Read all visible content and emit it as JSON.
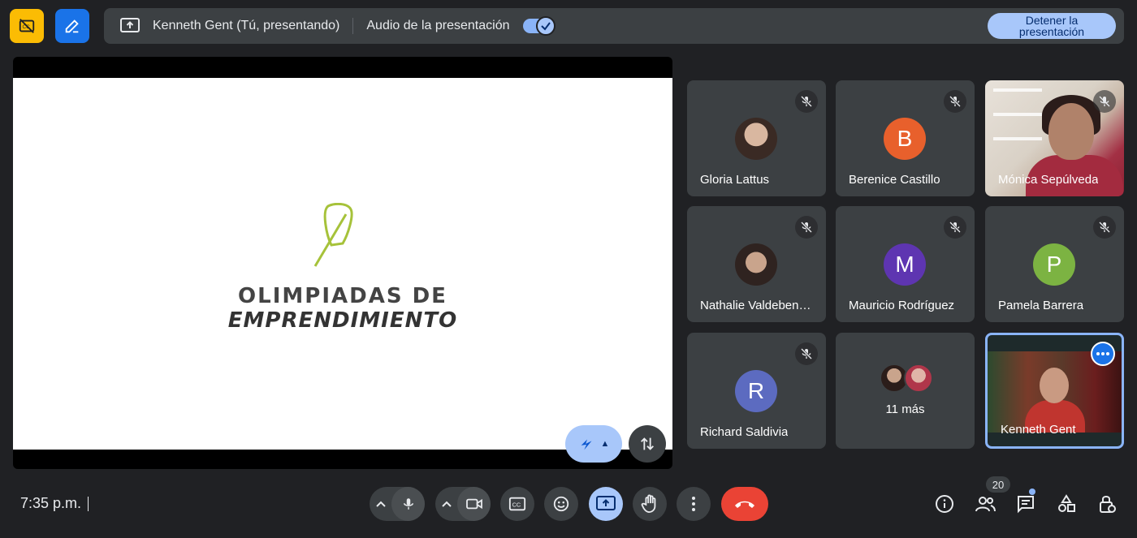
{
  "topbar": {
    "presenter_label": "Kenneth Gent (Tú, presentando)",
    "audio_label": "Audio de la presentación",
    "audio_enabled": true,
    "stop_button_label": "Detener la presentación"
  },
  "slide": {
    "line1": "OLIMPIADAS DE",
    "line2": "EMPRENDIMIENTO",
    "logo_color": "#a6c23a"
  },
  "participants": [
    {
      "name": "Gloria Lattus",
      "type": "photo",
      "muted": true
    },
    {
      "name": "Berenice Castillo",
      "type": "initial",
      "initial": "B",
      "color": "#e8602c",
      "muted": true
    },
    {
      "name": "Mónica Sepúlveda",
      "type": "video",
      "muted": true
    },
    {
      "name": "Nathalie Valdeben…",
      "type": "photo",
      "muted": true
    },
    {
      "name": "Mauricio Rodríguez",
      "type": "initial",
      "initial": "M",
      "color": "#5e35b1",
      "muted": true
    },
    {
      "name": "Pamela Barrera",
      "type": "initial",
      "initial": "P",
      "color": "#7cb342",
      "muted": true
    },
    {
      "name": "Richard Saldivia",
      "type": "initial",
      "initial": "R",
      "color": "#5c6bc0",
      "muted": true
    },
    {
      "name": "11 más",
      "type": "more"
    },
    {
      "name": "Kenneth Gent",
      "type": "self-video",
      "active": true
    }
  ],
  "bottombar": {
    "time": "7:35 p.m.",
    "participants_count": "20",
    "end_call_color": "#ea4335",
    "accent_color": "#a8c7fa"
  },
  "icons": {
    "top_left_1": "closed-caption-off-icon",
    "top_left_2": "pen-edit-icon",
    "present": "present-screen-icon",
    "mic": "mic-icon",
    "camera": "camera-icon",
    "captions": "captions-icon",
    "emoji": "emoji-icon",
    "present_now": "present-now-icon",
    "raise_hand": "raise-hand-icon",
    "more": "more-vert-icon",
    "end_call": "call-end-icon",
    "info": "info-icon",
    "people": "people-icon",
    "chat": "chat-icon",
    "activities": "activities-icon",
    "host_controls": "host-controls-icon"
  }
}
